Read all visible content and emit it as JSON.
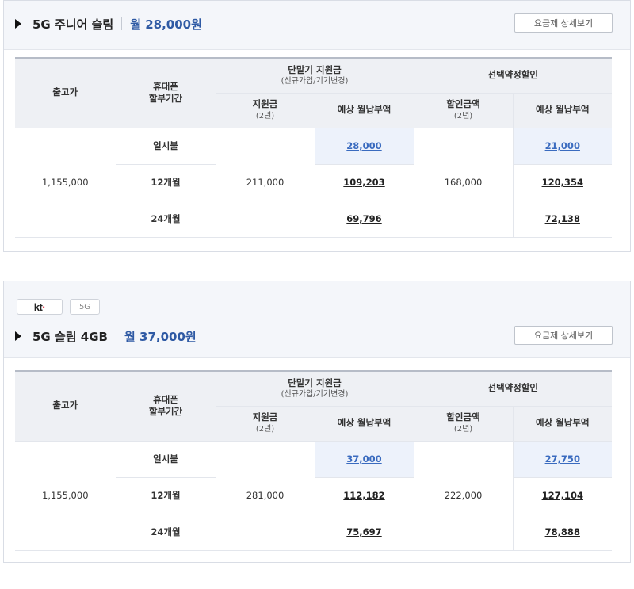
{
  "table_headers": {
    "release_price": "출고가",
    "installment_period_line1": "휴대폰",
    "installment_period_line2": "할부기간",
    "device_subsidy": "단말기 지원금",
    "device_subsidy_sub": "(신규가입/기기변경)",
    "selective_discount": "선택약정할인",
    "subsidy_amount": "지원금",
    "subsidy_amount_sub": "(2년)",
    "expected_monthly": "예상 월납부액",
    "discount_amount": "할인금액",
    "discount_amount_sub": "(2년)"
  },
  "plans": [
    {
      "carrier_badge": null,
      "gen_badge": null,
      "name": "5G 주니어 슬림",
      "monthly_price": "월 28,000원",
      "detail_button": "요금제 상세보기",
      "release_price": "1,155,000",
      "subsidy": "211,000",
      "discount": "168,000",
      "rows": [
        {
          "period": "일시불",
          "subsidy_monthly": "28,000",
          "discount_monthly": "21,000"
        },
        {
          "period": "12개월",
          "subsidy_monthly": "109,203",
          "discount_monthly": "120,354"
        },
        {
          "period": "24개월",
          "subsidy_monthly": "69,796",
          "discount_monthly": "72,138"
        }
      ]
    },
    {
      "carrier_badge": "kt",
      "gen_badge": "5G",
      "name": "5G 슬림 4GB",
      "monthly_price": "월 37,000원",
      "detail_button": "요금제 상세보기",
      "release_price": "1,155,000",
      "subsidy": "281,000",
      "discount": "222,000",
      "rows": [
        {
          "period": "일시불",
          "subsidy_monthly": "37,000",
          "discount_monthly": "27,750"
        },
        {
          "period": "12개월",
          "subsidy_monthly": "112,182",
          "discount_monthly": "127,104"
        },
        {
          "period": "24개월",
          "subsidy_monthly": "75,697",
          "discount_monthly": "78,888"
        }
      ]
    }
  ],
  "colors": {
    "accent_blue": "#2f5aa4",
    "highlight_cell": "#edf2fb",
    "kt_red": "#e3001b"
  },
  "icons": {
    "expand": "triangle-right-icon"
  }
}
